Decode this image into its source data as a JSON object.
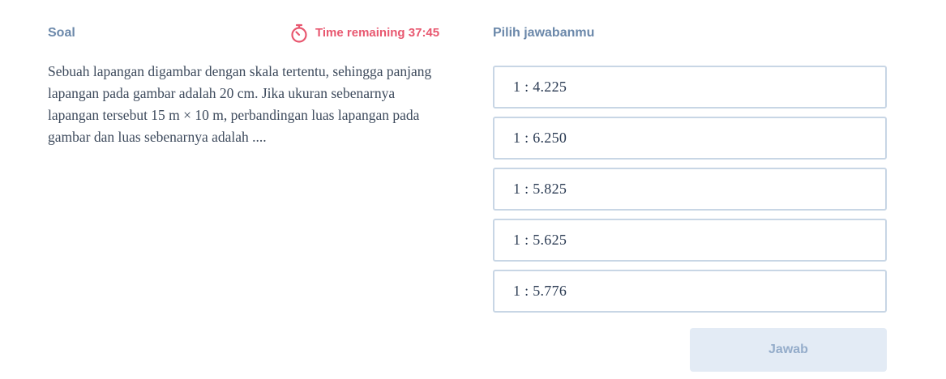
{
  "question_panel": {
    "title": "Soal",
    "timer_icon": "stopwatch-icon",
    "timer_text": "Time remaining 37:45",
    "question_text": "Sebuah lapangan digambar dengan skala tertentu, sehingga panjang lapangan pada gambar adalah 20 cm. Jika ukuran sebenarnya lapangan tersebut 15 m × 10 m, perbandingan luas lapangan pada gambar dan luas sebenarnya adalah ...."
  },
  "answer_panel": {
    "title": "Pilih jawabanmu",
    "options": [
      {
        "label": "1 : 4.225"
      },
      {
        "label": "1 : 6.250"
      },
      {
        "label": "1 : 5.825"
      },
      {
        "label": "1 : 5.625"
      },
      {
        "label": "1 : 5.776"
      }
    ],
    "submit_label": "Jawab"
  },
  "colors": {
    "label": "#6b88aa",
    "timer": "#e8576f",
    "option_border": "#c8d6e5",
    "submit_bg": "#e3ebf5",
    "submit_text": "#94acca"
  }
}
